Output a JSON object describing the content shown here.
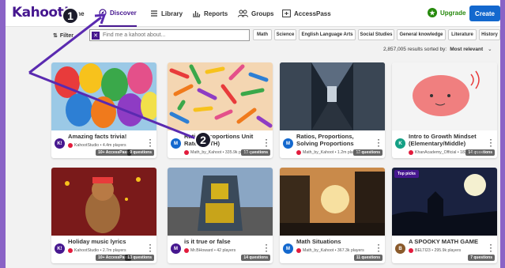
{
  "logo": "Kahoot!",
  "nav": {
    "home": "me",
    "discover": "Discover",
    "library": "Library",
    "reports": "Reports",
    "groups": "Groups",
    "accesspass": "AccessPass"
  },
  "upgrade": "Upgrade",
  "create": "Create",
  "filters": "Filter",
  "search": {
    "placeholder": "Find me a kahoot about..."
  },
  "chips": [
    "Math",
    "Science",
    "English Language Arts",
    "Social Studies",
    "General knowledge",
    "Literature",
    "History"
  ],
  "results": {
    "count": "2,857,005 results sorted by:",
    "sort": "Most relevant"
  },
  "cards": [
    {
      "title": "Amazing facts trivia!",
      "author": "KahootStudio • 4.4m players",
      "badge1": "10+ AccessPass",
      "badge2": "9 questions",
      "av": "K!",
      "avColor": "#46178f"
    },
    {
      "title": "Ratios, Proportions Unit Rate (MATH)",
      "author": "Math_by_Kahoot • 335.9k players",
      "badge1": "",
      "badge2": "13 questions",
      "av": "M",
      "avColor": "#1368ce"
    },
    {
      "title": "Ratios, Proportions, Solving Proportions",
      "author": "Math_by_Kahoot • 1.2m players",
      "badge1": "",
      "badge2": "13 questions",
      "av": "M",
      "avColor": "#1368ce"
    },
    {
      "title": "Intro to Growth Mindset (Elementary/Middle)",
      "author": "KhanAcademy_Official • 183k players",
      "badge1": "",
      "badge2": "14 questions",
      "av": "K",
      "avColor": "#14a085"
    },
    {
      "title": "Holiday music lyrics",
      "author": "KahootStudio • 2.7m players",
      "badge1": "10+ AccessPass",
      "badge2": "13 questions",
      "av": "K!",
      "avColor": "#46178f"
    },
    {
      "title": "is it true or false",
      "author": "Mr.BHoward • 42 players",
      "badge1": "",
      "badge2": "14 questions",
      "av": "M",
      "avColor": "#46178f"
    },
    {
      "title": "Math Situations",
      "author": "Math_by_Kahoot • 367.3k players",
      "badge1": "",
      "badge2": "11 questions",
      "av": "M",
      "avColor": "#1368ce"
    },
    {
      "title": "A SPOOKY MATH GAME",
      "author": "BELTI23 • 295.9k players",
      "badge1": "Top picks",
      "badge2": "7 questions",
      "av": "B",
      "avColor": "#8a5a2b"
    }
  ],
  "callouts": [
    "1",
    "2"
  ]
}
